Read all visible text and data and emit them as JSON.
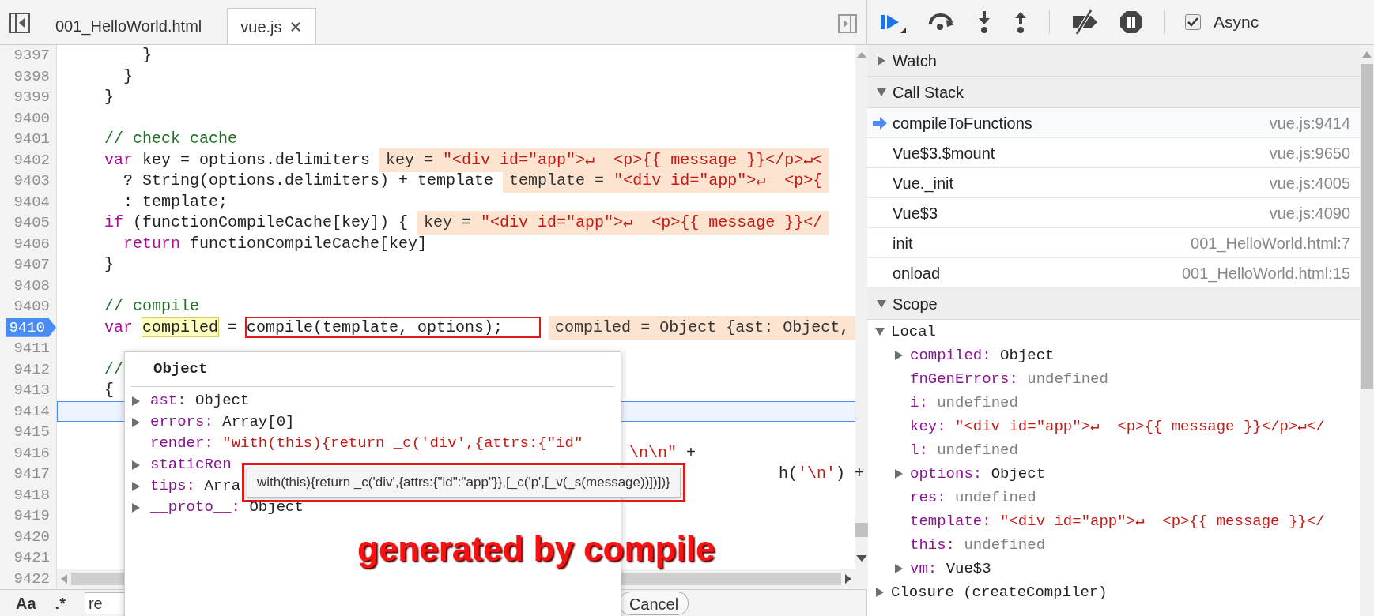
{
  "tabs": [
    {
      "label": "001_HelloWorld.html",
      "selected": false,
      "closable": false
    },
    {
      "label": "vue.js",
      "selected": true,
      "closable": true
    }
  ],
  "editor": {
    "lines": [
      {
        "number": "9397",
        "breakpoint": false,
        "current": false,
        "segments": [
          {
            "text": "        }",
            "kind": "plain"
          }
        ]
      },
      {
        "number": "9398",
        "breakpoint": false,
        "current": false,
        "segments": [
          {
            "text": "      }",
            "kind": "plain"
          }
        ]
      },
      {
        "number": "9399",
        "breakpoint": false,
        "current": false,
        "segments": [
          {
            "text": "    }",
            "kind": "plain"
          }
        ]
      },
      {
        "number": "9400",
        "breakpoint": false,
        "current": false
      },
      {
        "number": "9401",
        "breakpoint": false,
        "current": false,
        "segments": [
          {
            "text": "    // check cache",
            "kind": "comment"
          }
        ]
      },
      {
        "number": "9402",
        "breakpoint": false,
        "current": false,
        "segments": [
          {
            "text": "    var",
            "kind": "keyword"
          },
          {
            "text": " key = options.delimiters",
            "kind": "plain"
          }
        ],
        "hint": [
          {
            "text": "key = ",
            "kind": "name"
          },
          {
            "text": "\"<div id=\"app\">↵  <p>{{ message }}</p>↵<",
            "kind": "string"
          }
        ]
      },
      {
        "number": "9403",
        "breakpoint": false,
        "current": false,
        "segments": [
          {
            "text": "      ? String(options.delimiters) + template",
            "kind": "plain"
          }
        ],
        "hint": [
          {
            "text": "template = ",
            "kind": "name"
          },
          {
            "text": "\"<div id=\"app\">↵  <p>{",
            "kind": "string"
          }
        ]
      },
      {
        "number": "9404",
        "breakpoint": false,
        "current": false,
        "segments": [
          {
            "text": "      : template;",
            "kind": "plain"
          }
        ]
      },
      {
        "number": "9405",
        "breakpoint": false,
        "current": false,
        "segments": [
          {
            "text": "    if",
            "kind": "keyword"
          },
          {
            "text": " (functionCompileCache[key]) {",
            "kind": "plain"
          }
        ],
        "hint": [
          {
            "text": "key = ",
            "kind": "name"
          },
          {
            "text": "\"<div id=\"app\">↵  <p>{{ message }}</",
            "kind": "string"
          }
        ]
      },
      {
        "number": "9406",
        "breakpoint": false,
        "current": false,
        "segments": [
          {
            "text": "      return",
            "kind": "keyword"
          },
          {
            "text": " functionCompileCache[key]",
            "kind": "plain"
          }
        ]
      },
      {
        "number": "9407",
        "breakpoint": false,
        "current": false,
        "segments": [
          {
            "text": "    }",
            "kind": "plain"
          }
        ]
      },
      {
        "number": "9408",
        "breakpoint": false,
        "current": false
      },
      {
        "number": "9409",
        "breakpoint": false,
        "current": false,
        "segments": [
          {
            "text": "    // compile",
            "kind": "comment"
          }
        ]
      },
      {
        "number": "9410",
        "breakpoint": true,
        "current": false,
        "segments": [
          {
            "text": "    var ",
            "kind": "keyword"
          },
          {
            "text": "compiled",
            "kind": "highlighted"
          },
          {
            "text": " = ",
            "kind": "plain"
          },
          {
            "text": "compile(template, options);",
            "kind": "boxed"
          }
        ],
        "hint": [
          {
            "text": "compiled = Object {ast: Object,",
            "kind": "name"
          }
        ]
      },
      {
        "number": "9411",
        "breakpoint": false,
        "current": false
      },
      {
        "number": "9412",
        "breakpoint": false,
        "current": false,
        "segments": [
          {
            "text": "    //",
            "kind": "comment"
          }
        ]
      },
      {
        "number": "9413",
        "breakpoint": false,
        "current": false,
        "segments": [
          {
            "text": "    {",
            "kind": "plain"
          }
        ]
      },
      {
        "number": "9414",
        "breakpoint": false,
        "current": true
      },
      {
        "number": "9415",
        "breakpoint": false,
        "current": false
      },
      {
        "number": "9416",
        "breakpoint": false,
        "current": false,
        "tail": {
          "segments": [
            {
              "text": "\\n\\n\"",
              "kind": "string"
            },
            {
              "text": " +",
              "kind": "plain"
            }
          ]
        }
      },
      {
        "number": "9417",
        "breakpoint": false,
        "current": false,
        "tail": {
          "segments": [
            {
              "text": "h(",
              "kind": "plain"
            },
            {
              "text": "'\\n'",
              "kind": "string"
            },
            {
              "text": ") +",
              "kind": "plain"
            }
          ]
        }
      },
      {
        "number": "9418",
        "breakpoint": false,
        "current": false
      },
      {
        "number": "9419",
        "breakpoint": false,
        "current": false
      },
      {
        "number": "9420",
        "breakpoint": false,
        "current": false
      },
      {
        "number": "9421",
        "breakpoint": false,
        "current": false
      },
      {
        "number": "9422",
        "breakpoint": false,
        "current": false
      }
    ]
  },
  "search_bar": {
    "case_toggle": "Aa",
    "regex_toggle": ".*",
    "value": "re",
    "cancel": "Cancel"
  },
  "object_popover": {
    "title": "Object",
    "properties": [
      {
        "name": "ast:",
        "value": "Object",
        "kind": "object",
        "expanded": false
      },
      {
        "name": "errors:",
        "value": "Array[0]",
        "kind": "object",
        "expanded": false
      },
      {
        "name": "render:",
        "value": "\"with(this){return _c('div',{attrs:{\"id\"",
        "kind": "string"
      },
      {
        "name": "staticRen",
        "kind": "object",
        "expanded": false
      },
      {
        "name": "tips:",
        "value": "Arra",
        "kind": "object",
        "expanded": false
      },
      {
        "name": "__proto__:",
        "value": "Object",
        "kind": "object",
        "expanded": false
      }
    ]
  },
  "tooltip": "with(this){return _c('div',{attrs:{\"id\":\"app\"}},[_c('p',[_v(_s(message))])])}",
  "annotation": "generated by compile",
  "debugger_toolbar": {
    "async": {
      "label": "Async",
      "checked": true
    }
  },
  "watch": {
    "title": "Watch",
    "expanded": false
  },
  "call_stack": {
    "title": "Call Stack",
    "expanded": true,
    "frames": [
      {
        "function": "compileToFunctions",
        "location": "vue.js:9414",
        "selected": true
      },
      {
        "function": "Vue$3.$mount",
        "location": "vue.js:9650",
        "selected": false
      },
      {
        "function": "Vue._init",
        "location": "vue.js:4005",
        "selected": false
      },
      {
        "function": "Vue$3",
        "location": "vue.js:4090",
        "selected": false
      },
      {
        "function": "init",
        "location": "001_HelloWorld.html:7",
        "selected": false
      },
      {
        "function": "onload",
        "location": "001_HelloWorld.html:15",
        "selected": false
      }
    ]
  },
  "scope": {
    "title": "Scope",
    "expanded": true,
    "scopes": [
      {
        "title": "Local",
        "expanded": true,
        "variables": [
          {
            "name": "compiled:",
            "value": "Object",
            "kind": "object",
            "expanded": false
          },
          {
            "name": "fnGenErrors:",
            "value": "undefined",
            "kind": "undefined"
          },
          {
            "name": "i:",
            "value": "undefined",
            "kind": "undefined"
          },
          {
            "name": "key:",
            "value": "\"<div id=\"app\">↵  <p>{{ message }}</p>↵</",
            "kind": "string"
          },
          {
            "name": "l:",
            "value": "undefined",
            "kind": "undefined"
          },
          {
            "name": "options:",
            "value": "Object",
            "kind": "object",
            "expanded": false
          },
          {
            "name": "res:",
            "value": "undefined",
            "kind": "undefined"
          },
          {
            "name": "template:",
            "value": "\"<div id=\"app\">↵  <p>{{ message }}</",
            "kind": "string"
          },
          {
            "name": "this:",
            "value": "undefined",
            "kind": "undefined"
          },
          {
            "name": "vm:",
            "value": "Vue$3",
            "kind": "object",
            "expanded": false
          }
        ]
      },
      {
        "title": "Closure (createCompiler)",
        "expanded": false
      }
    ]
  }
}
